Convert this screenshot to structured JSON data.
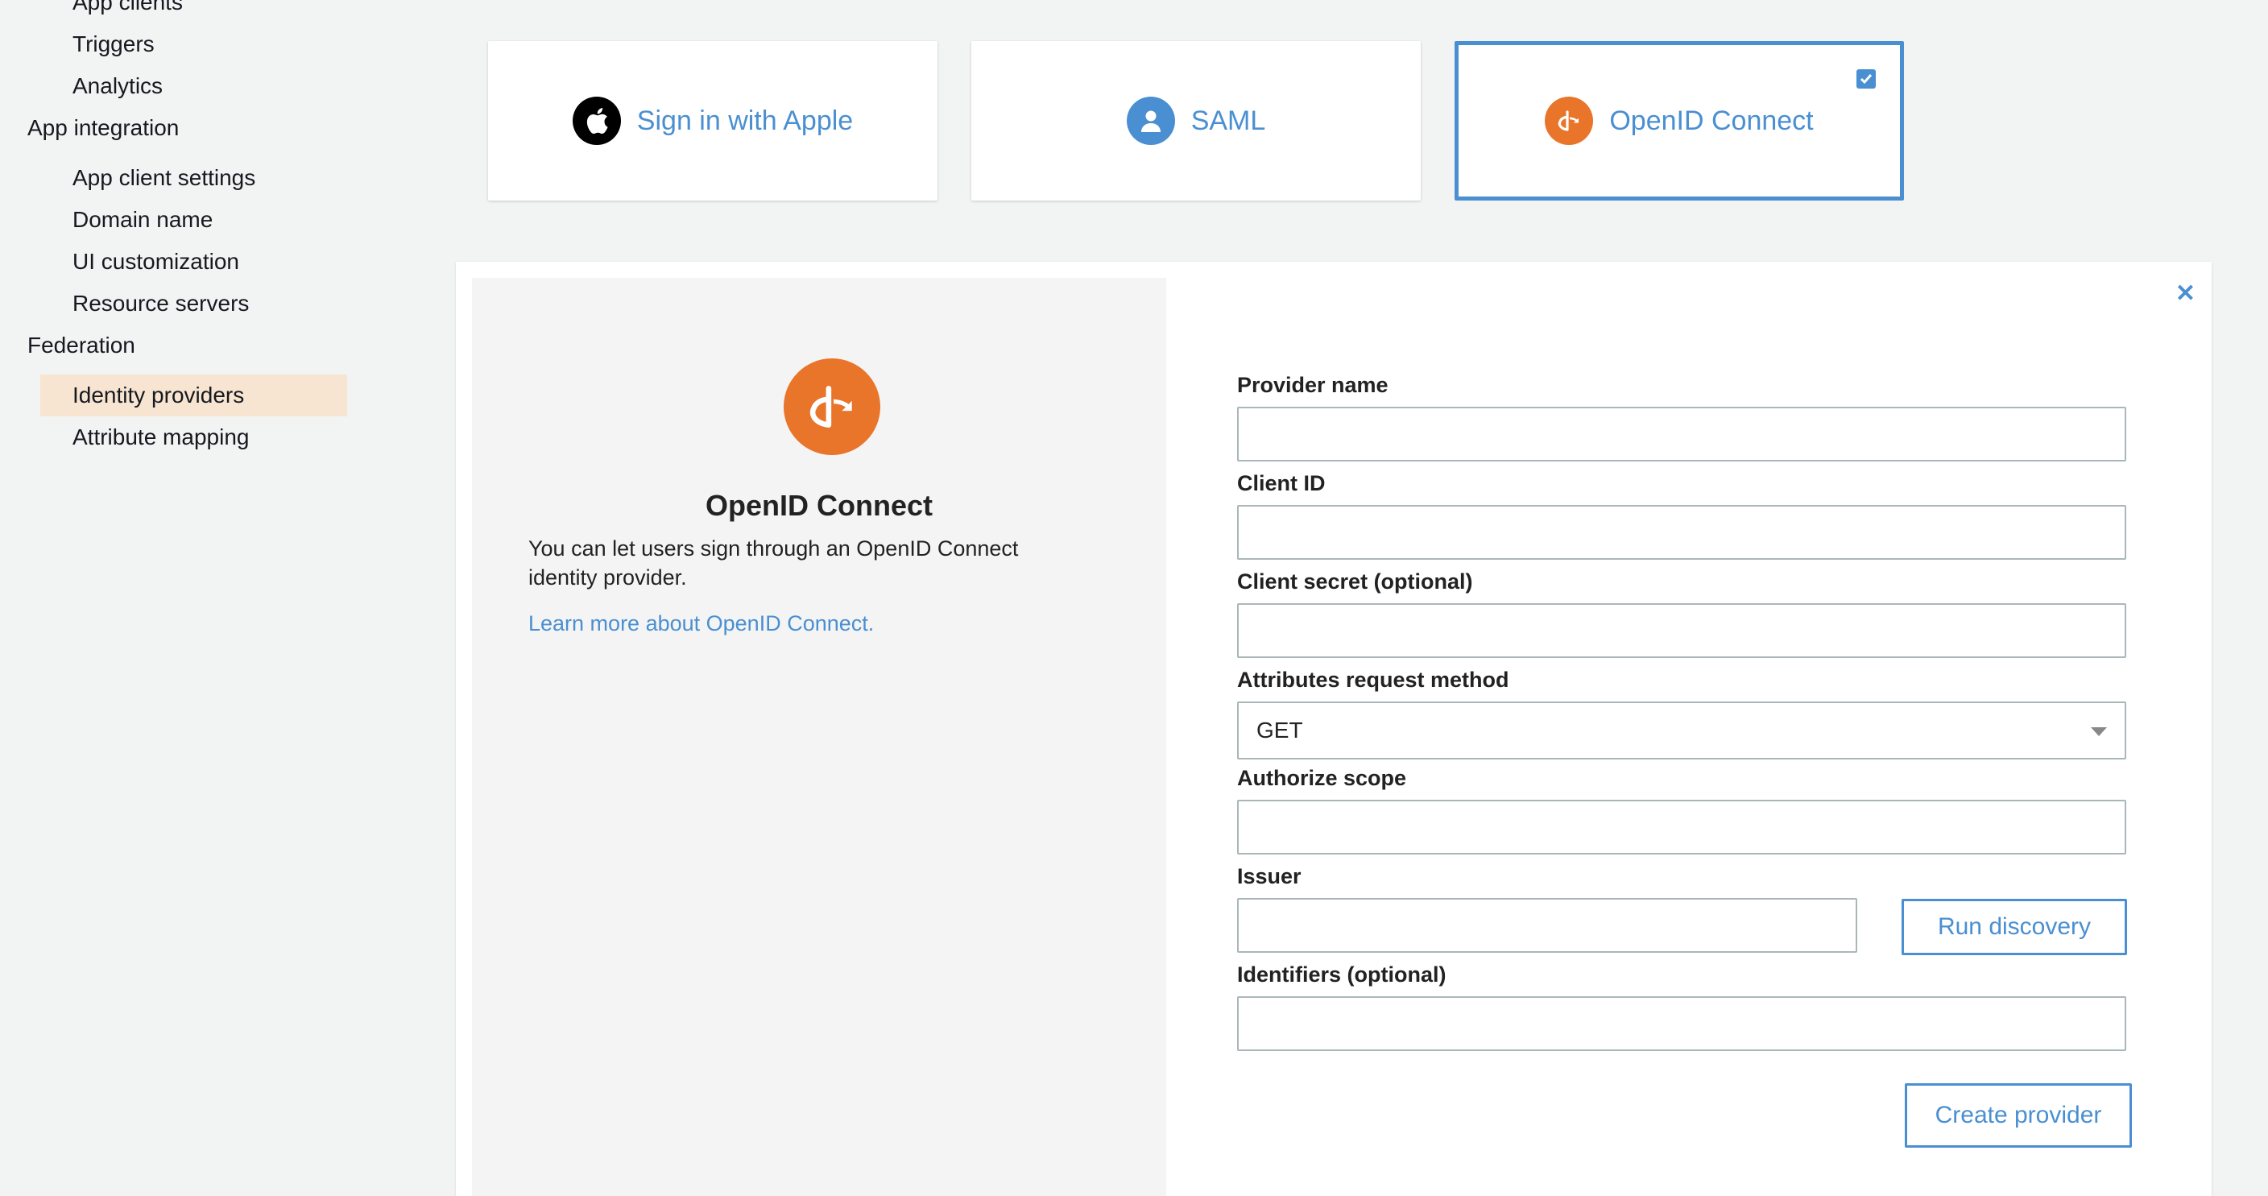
{
  "sidebar": {
    "items": [
      {
        "label": "App clients"
      },
      {
        "label": "Triggers"
      },
      {
        "label": "Analytics"
      },
      {
        "label": "App integration"
      },
      {
        "label": "App client settings"
      },
      {
        "label": "Domain name"
      },
      {
        "label": "UI customization"
      },
      {
        "label": "Resource servers"
      },
      {
        "label": "Federation"
      },
      {
        "label": "Identity providers"
      },
      {
        "label": "Attribute mapping"
      }
    ],
    "active_item": "Identity providers"
  },
  "providers": [
    {
      "label": "Sign in with Apple",
      "icon": "apple-icon"
    },
    {
      "label": "SAML",
      "icon": "user-icon"
    },
    {
      "label": "OpenID Connect",
      "icon": "openid-icon",
      "selected": true
    }
  ],
  "info": {
    "title": "OpenID Connect",
    "description": "You can let users sign through an OpenID Connect identity provider.",
    "link": "Learn more about OpenID Connect."
  },
  "form": {
    "provider_name": {
      "label": "Provider name",
      "value": ""
    },
    "client_id": {
      "label": "Client ID",
      "value": ""
    },
    "client_secret": {
      "label": "Client secret (optional)",
      "value": ""
    },
    "attributes_method": {
      "label": "Attributes request method",
      "value": "GET"
    },
    "authorize_scope": {
      "label": "Authorize scope",
      "value": ""
    },
    "issuer": {
      "label": "Issuer",
      "value": ""
    },
    "identifiers": {
      "label": "Identifiers (optional)",
      "value": ""
    },
    "run_discovery_label": "Run discovery",
    "create_label": "Create provider"
  },
  "colors": {
    "accent": "#4a8fd1",
    "openid_orange": "#e8752a",
    "active_nav_bg": "#f7e5d1"
  }
}
